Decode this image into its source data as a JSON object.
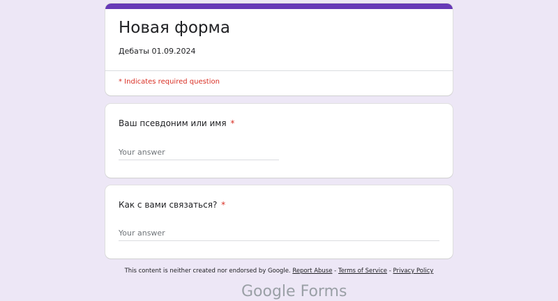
{
  "form": {
    "title": "Новая форма",
    "description": "Дебаты 01.09.2024",
    "required_note": "* Indicates required question",
    "accent_color": "#673ab7",
    "background_color": "#ede7f6"
  },
  "questions": [
    {
      "title": "Ваш псевдоним или имя",
      "required_mark": "*",
      "placeholder": "Your answer",
      "value": ""
    },
    {
      "title": "Как с вами связаться?",
      "required_mark": "*",
      "placeholder": "Your answer",
      "value": ""
    }
  ],
  "footer": {
    "disclaimer": "This content is neither created nor endorsed by Google.",
    "links": {
      "report_abuse": "Report Abuse",
      "terms": "Terms of Service",
      "privacy": "Privacy Policy"
    },
    "separator": " - ",
    "logo_text": "Google Forms"
  }
}
